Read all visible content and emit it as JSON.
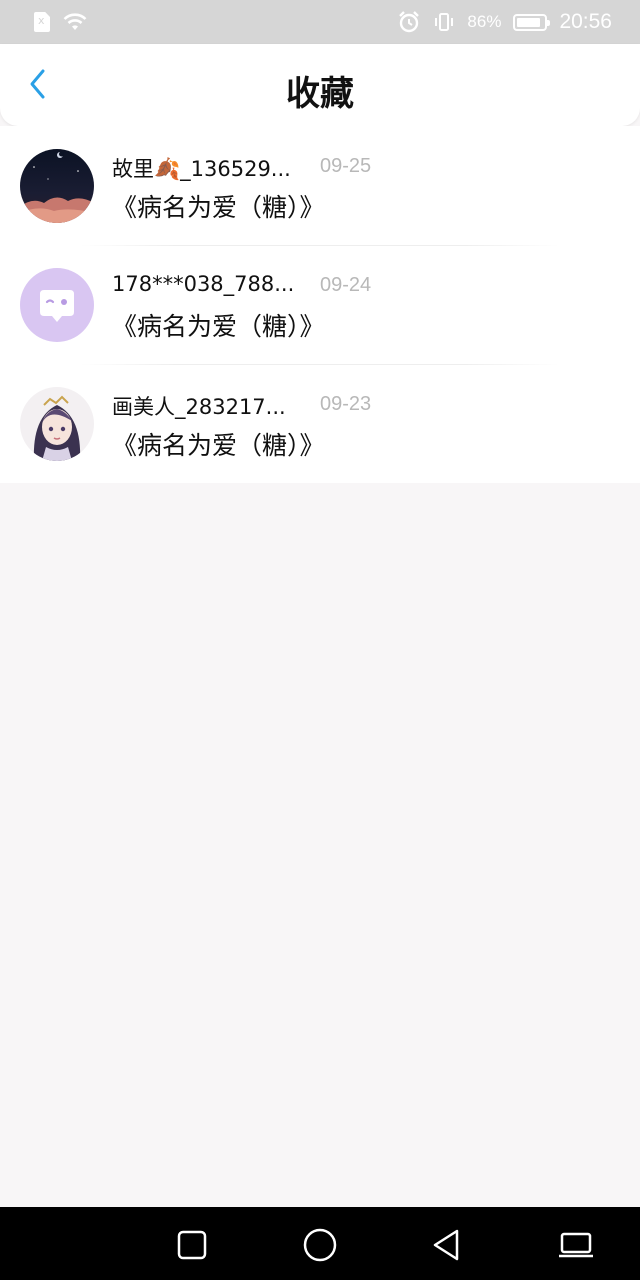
{
  "status_bar": {
    "battery_percent": "86%",
    "time": "20:56",
    "battery_level": 0.86
  },
  "header": {
    "title": "收藏"
  },
  "favorites": [
    {
      "user": "故里🍂_136529...",
      "date": "09-25",
      "title": "《病名为爱（糖）》"
    },
    {
      "user": "178***038_788...",
      "date": "09-24",
      "title": "《病名为爱（糖）》"
    },
    {
      "user": "画美人_283217...",
      "date": "09-23",
      "title": "《病名为爱（糖）》"
    }
  ],
  "colors": {
    "accent": "#2aa0e6",
    "date_gray": "#b8b8b8",
    "avatar_purple": "#d9c6f2"
  },
  "icons": {
    "back": "chevron-left-icon",
    "nav_recent": "square-icon",
    "nav_home": "circle-icon",
    "nav_back": "triangle-back-icon",
    "nav_extra": "laptop-icon"
  }
}
